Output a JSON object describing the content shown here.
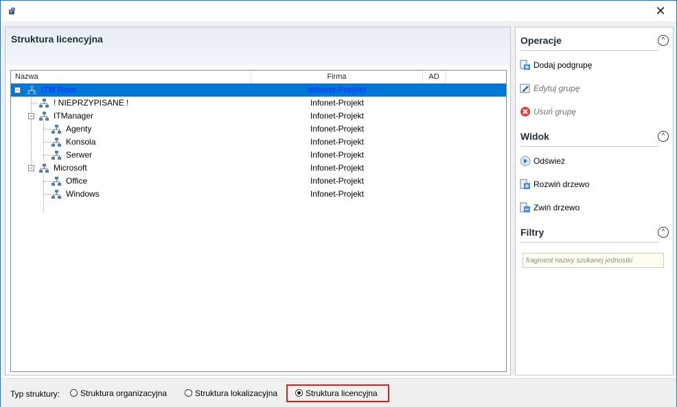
{
  "window": {
    "close_label": "✕"
  },
  "left_panel": {
    "title": "Struktura licencyjna",
    "columns": [
      "Nazwa",
      "Firma",
      "AD"
    ],
    "rows": [
      {
        "name": "ITM Root",
        "firma": "Infonet-Projekt",
        "selected": true
      },
      {
        "name": "! NIEPRZYPISANE !",
        "firma": "Infonet-Projekt"
      },
      {
        "name": "ITManager",
        "firma": "Infonet-Projekt"
      },
      {
        "name": "Agenty",
        "firma": "Infonet-Projekt"
      },
      {
        "name": "Konsola",
        "firma": "Infonet-Projekt"
      },
      {
        "name": "Serwer",
        "firma": "Infonet-Projekt"
      },
      {
        "name": "Microsoft",
        "firma": "Infonet-Projekt"
      },
      {
        "name": "Office",
        "firma": "Infonet-Projekt"
      },
      {
        "name": "Windows",
        "firma": "Infonet-Projekt"
      }
    ],
    "expander_minus": "−"
  },
  "right_panel": {
    "operacje": {
      "title": "Operacje",
      "collapse_glyph": "^",
      "items": [
        {
          "label": "Dodaj podgrupę",
          "icon": "add-subgroup-icon",
          "enabled": true
        },
        {
          "label": "Edytuj grupę",
          "icon": "edit-group-icon",
          "enabled": false
        },
        {
          "label": "Usuń grupę",
          "icon": "delete-group-icon",
          "enabled": false
        }
      ]
    },
    "widok": {
      "title": "Widok",
      "collapse_glyph": "^",
      "items": [
        {
          "label": "Odśwież",
          "icon": "refresh-icon"
        },
        {
          "label": "Rozwiń drzewo",
          "icon": "expand-tree-icon"
        },
        {
          "label": "Zwiń drzewo",
          "icon": "collapse-tree-icon"
        }
      ]
    },
    "filtry": {
      "title": "Filtry",
      "collapse_glyph": "^",
      "placeholder": "fragment nazwy szukanej jednostki"
    }
  },
  "statusbar": {
    "label": "Typ struktury:",
    "options": [
      {
        "label": "Struktura organizacyjna",
        "checked": false
      },
      {
        "label": "Struktura lokalizacyjna",
        "checked": false
      },
      {
        "label": "Struktura licencyjna",
        "checked": true
      }
    ]
  },
  "colors": {
    "selection": "#0078d7",
    "selected_text": "#1a3cff",
    "highlight_box": "#e21d1d",
    "window_border": "#1e6fc6"
  }
}
